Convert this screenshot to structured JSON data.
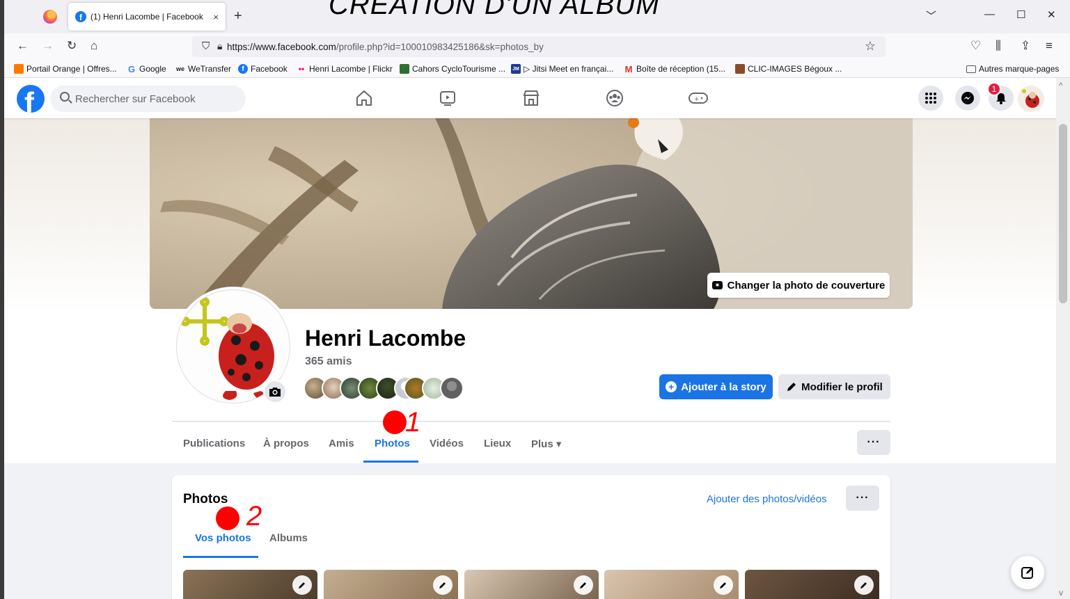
{
  "overlay": {
    "title": "CRÉATION D'UN ALBUM",
    "anno1": "1",
    "anno2": "2"
  },
  "browser": {
    "tab_title": "(1) Henri Lacombe | Facebook",
    "tab_close": "×",
    "new_tab": "+",
    "url_domain": "https://www.facebook.com",
    "url_path": "/profile.php?id=100010983425186&sk=photos_by",
    "window_controls": [
      "﹀",
      "—",
      "☐",
      "✕"
    ],
    "bookmarks": [
      {
        "label": "Portail Orange | Offres...",
        "icon": "orange-square-icon",
        "color": "#ff7900"
      },
      {
        "label": "Google",
        "icon": "google-g-icon",
        "color": "#4285f4"
      },
      {
        "label": "WeTransfer",
        "icon": "wetransfer-icon",
        "color": "#222222"
      },
      {
        "label": "Facebook",
        "icon": "facebook-icon",
        "color": "#1877f2"
      },
      {
        "label": "Henri Lacombe | Flickr",
        "icon": "flickr-icon",
        "color": "#ff0084"
      },
      {
        "label": "Cahors CycloTourisme ...",
        "icon": "cahors-icon",
        "color": "#2f6f2f"
      },
      {
        "label": "▷ Jitsi Meet en françai...",
        "icon": "jitsi-icon",
        "color": "#1d3c8f"
      },
      {
        "label": "Boîte de réception (15...",
        "icon": "gmail-icon",
        "color": "#d93025"
      },
      {
        "label": "CLIC-IMAGES Bégoux ...",
        "icon": "clic-images-icon",
        "color": "#8a4b2a"
      }
    ],
    "other_bookmarks": "Autres marque-pages"
  },
  "fb": {
    "search_placeholder": "Rechercher sur Facebook",
    "notif_count": "1",
    "cover_button": "Changer la photo de couverture",
    "name": "Henri Lacombe",
    "friends": "365 amis",
    "add_story": "Ajouter à la story",
    "edit_profile": "Modifier le profil",
    "tabs": [
      {
        "label": "Publications"
      },
      {
        "label": "À propos"
      },
      {
        "label": "Amis"
      },
      {
        "label": "Photos",
        "active": true
      },
      {
        "label": "Vidéos"
      },
      {
        "label": "Lieux"
      },
      {
        "label": "Plus ▾"
      }
    ],
    "more_dots": "···",
    "photos": {
      "title": "Photos",
      "add_link": "Ajouter des photos/vidéos",
      "sub_tabs": [
        {
          "label": "Vos photos",
          "active": true
        },
        {
          "label": "Albums"
        }
      ]
    }
  },
  "colors": {
    "fb_blue": "#1877f2",
    "annotation_red": "#ff0000"
  }
}
